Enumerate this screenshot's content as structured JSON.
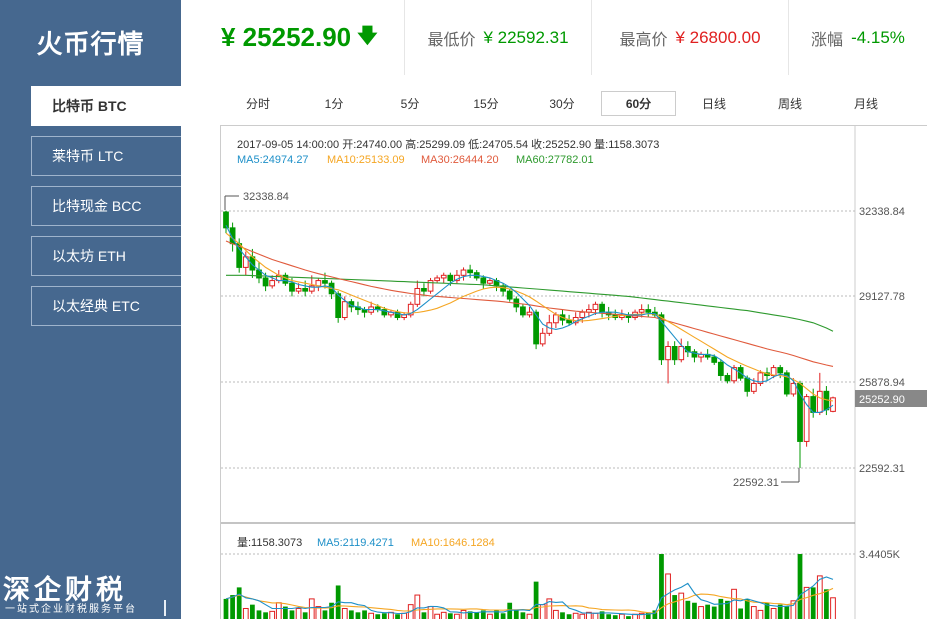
{
  "sidebar": {
    "brand": "火币行情",
    "items": [
      {
        "label": "比特币 BTC",
        "active": true
      },
      {
        "label": "莱特币 LTC",
        "active": false
      },
      {
        "label": "比特现金 BCC",
        "active": false
      },
      {
        "label": "以太坊 ETH",
        "active": false
      },
      {
        "label": "以太经典 ETC",
        "active": false
      }
    ],
    "watermark_title": "深企财税",
    "watermark_sub": "一站式企业财税服务平台"
  },
  "header": {
    "price": "¥ 25252.90",
    "low_label": "最低价",
    "low_value": "¥ 22592.31",
    "high_label": "最高价",
    "high_value": "¥ 26800.00",
    "change_label": "涨幅",
    "change_value": "-4.15%"
  },
  "tabs": [
    {
      "label": "分时",
      "active": false
    },
    {
      "label": "1分",
      "active": false
    },
    {
      "label": "5分",
      "active": false
    },
    {
      "label": "15分",
      "active": false
    },
    {
      "label": "30分",
      "active": false
    },
    {
      "label": "60分",
      "active": true
    },
    {
      "label": "日线",
      "active": false
    },
    {
      "label": "周线",
      "active": false
    },
    {
      "label": "月线",
      "active": false
    }
  ],
  "chart_info": {
    "line1": "2017-09-05 14:00:00   开:24740.00 高:25299.09 低:24705.54 收:25252.90 量:1158.3073",
    "ma5": "MA5:24974.27",
    "ma10": "MA10:25133.09",
    "ma30": "MA30:26444.20",
    "ma60": "MA60:27782.01",
    "vol": "量:1158.3073",
    "vol_ma5": "MA5:2119.4271",
    "vol_ma10": "MA10:1646.1284"
  },
  "colors": {
    "up": "#e02020",
    "down": "#009900",
    "ma5": "#1e90c8",
    "ma10": "#f5a623",
    "ma30": "#e05a3c",
    "ma60": "#2e9a2e",
    "sidebar": "#46688f"
  },
  "chart_data": {
    "type": "candlestick",
    "axis_ticks": [
      "32338.84",
      "29127.78",
      "25878.94",
      "22592.31"
    ],
    "current_price_tag": "25252.90",
    "max_label": "32338.84",
    "min_label": "22592.31",
    "vol_tick": "3.4405K",
    "ylim": [
      22592.31,
      32338.84
    ],
    "vol_max": 3440.5,
    "candles": [
      [
        32300,
        31700,
        32339,
        31500
      ],
      [
        31700,
        31100,
        31900,
        30800
      ],
      [
        31100,
        30200,
        31300,
        30000
      ],
      [
        30200,
        30600,
        30800,
        29900
      ],
      [
        30600,
        30100,
        30900,
        29800
      ],
      [
        30100,
        29800,
        30400,
        29600
      ],
      [
        29800,
        29500,
        30000,
        29300
      ],
      [
        29500,
        29700,
        29900,
        29400
      ],
      [
        29700,
        29900,
        30100,
        29600
      ],
      [
        29900,
        29600,
        30000,
        29500
      ],
      [
        29600,
        29300,
        29800,
        29100
      ],
      [
        29300,
        29400,
        29600,
        29200
      ],
      [
        29400,
        29300,
        29700,
        29100
      ],
      [
        29300,
        29500,
        29900,
        29200
      ],
      [
        29500,
        29700,
        29800,
        29300
      ],
      [
        29700,
        29600,
        30000,
        29400
      ],
      [
        29600,
        29200,
        29700,
        29000
      ],
      [
        29200,
        28300,
        29300,
        28100
      ],
      [
        28300,
        28900,
        29100,
        28200
      ],
      [
        28900,
        28700,
        29000,
        28500
      ],
      [
        28700,
        28600,
        28900,
        28400
      ],
      [
        28600,
        28500,
        28700,
        28300
      ],
      [
        28500,
        28700,
        28900,
        28400
      ],
      [
        28700,
        28600,
        28800,
        28500
      ],
      [
        28600,
        28400,
        28700,
        28300
      ],
      [
        28400,
        28500,
        28600,
        28300
      ],
      [
        28500,
        28300,
        28600,
        28200
      ],
      [
        28300,
        28400,
        28500,
        28200
      ],
      [
        28400,
        28800,
        28900,
        28300
      ],
      [
        28800,
        29400,
        29700,
        28700
      ],
      [
        29400,
        29300,
        29600,
        29100
      ],
      [
        29300,
        29700,
        29800,
        29200
      ],
      [
        29700,
        29800,
        29900,
        29600
      ],
      [
        29800,
        29900,
        30000,
        29600
      ],
      [
        29900,
        29700,
        30000,
        29500
      ],
      [
        29700,
        29900,
        30100,
        29600
      ],
      [
        29900,
        30100,
        30200,
        29700
      ],
      [
        30100,
        30000,
        30300,
        29800
      ],
      [
        30000,
        29800,
        30100,
        29700
      ],
      [
        29800,
        29600,
        29900,
        29400
      ],
      [
        29600,
        29700,
        29800,
        29500
      ],
      [
        29700,
        29500,
        29800,
        29300
      ],
      [
        29500,
        29300,
        29600,
        29100
      ],
      [
        29300,
        29000,
        29400,
        28900
      ],
      [
        29000,
        28700,
        29100,
        28500
      ],
      [
        28700,
        28400,
        28800,
        28300
      ],
      [
        28400,
        28500,
        28700,
        28300
      ],
      [
        28500,
        27300,
        28600,
        27100
      ],
      [
        27300,
        27700,
        27900,
        27200
      ],
      [
        27700,
        28100,
        28400,
        27600
      ],
      [
        28100,
        28400,
        28500,
        27900
      ],
      [
        28400,
        28200,
        28600,
        28000
      ],
      [
        28200,
        28100,
        28400,
        28000
      ],
      [
        28100,
        28300,
        28500,
        28000
      ],
      [
        28300,
        28500,
        28600,
        28100
      ],
      [
        28500,
        28600,
        28800,
        28300
      ],
      [
        28600,
        28800,
        28900,
        28400
      ],
      [
        28800,
        28500,
        28900,
        28300
      ],
      [
        28500,
        28400,
        28700,
        28200
      ],
      [
        28400,
        28300,
        28600,
        28200
      ],
      [
        28300,
        28400,
        28600,
        28200
      ],
      [
        28400,
        28300,
        28500,
        28100
      ],
      [
        28300,
        28500,
        28600,
        28200
      ],
      [
        28500,
        28600,
        28800,
        28300
      ],
      [
        28600,
        28500,
        28800,
        28300
      ],
      [
        28500,
        28400,
        28700,
        28300
      ],
      [
        28400,
        26700,
        28500,
        26500
      ],
      [
        26700,
        27200,
        27400,
        25800
      ],
      [
        27200,
        26700,
        27400,
        26500
      ],
      [
        26700,
        27200,
        27500,
        26600
      ],
      [
        27200,
        27000,
        27400,
        26800
      ],
      [
        27000,
        26800,
        27100,
        26600
      ],
      [
        26800,
        26900,
        27000,
        26600
      ],
      [
        26900,
        26800,
        27100,
        26700
      ],
      [
        26800,
        26600,
        26900,
        26500
      ],
      [
        26600,
        26100,
        26700,
        25900
      ],
      [
        26100,
        25900,
        26200,
        25800
      ],
      [
        25900,
        26400,
        26500,
        25800
      ],
      [
        26400,
        26000,
        26500,
        25900
      ],
      [
        26000,
        25500,
        26100,
        25300
      ],
      [
        25500,
        25800,
        26000,
        25400
      ],
      [
        25800,
        26200,
        26300,
        25700
      ],
      [
        26200,
        26100,
        26400,
        25900
      ],
      [
        26100,
        26400,
        26500,
        26000
      ],
      [
        26400,
        26200,
        26500,
        26000
      ],
      [
        26200,
        25400,
        26300,
        25300
      ],
      [
        25400,
        25800,
        26000,
        25300
      ],
      [
        25800,
        23600,
        25900,
        22592
      ],
      [
        23600,
        25300,
        25400,
        23400
      ],
      [
        25300,
        24700,
        25600,
        24500
      ],
      [
        24700,
        25500,
        26200,
        24600
      ],
      [
        25500,
        24800,
        25700,
        24600
      ],
      [
        24740,
        25253,
        25299,
        24705
      ]
    ],
    "volumes": [
      1100,
      1300,
      1700,
      600,
      800,
      500,
      400,
      450,
      900,
      700,
      500,
      600,
      400,
      1100,
      700,
      500,
      900,
      1800,
      600,
      500,
      400,
      500,
      350,
      300,
      350,
      400,
      300,
      350,
      800,
      1300,
      400,
      700,
      300,
      400,
      350,
      300,
      500,
      450,
      400,
      500,
      300,
      500,
      350,
      900,
      500,
      400,
      300,
      2000,
      800,
      1100,
      500,
      400,
      300,
      350,
      300,
      400,
      350,
      450,
      300,
      250,
      300,
      200,
      300,
      350,
      400,
      500,
      3440,
      2400,
      1300,
      1400,
      1000,
      900,
      700,
      800,
      700,
      1100,
      1000,
      1600,
      600,
      1100,
      700,
      500,
      900,
      600,
      800,
      700,
      1000,
      3440,
      1700,
      1700,
      2300,
      1600,
      1158
    ],
    "ma5": [
      31800,
      31300,
      30900,
      30600,
      30300,
      30100,
      29900,
      29800,
      29700,
      29700,
      29650,
      29550,
      29500,
      29450,
      29450,
      29500,
      29450,
      29150,
      28950,
      28750,
      28700,
      28600,
      28600,
      28600,
      28550,
      28500,
      28450,
      28400,
      28450,
      28600,
      28800,
      29000,
      29200,
      29400,
      29600,
      29750,
      29850,
      29900,
      29900,
      29850,
      29800,
      29700,
      29600,
      29450,
      29250,
      29000,
      28750,
      28400,
      28050,
      27900,
      27850,
      27900,
      28000,
      28150,
      28250,
      28350,
      28450,
      28500,
      28500,
      28500,
      28450,
      28400,
      28400,
      28400,
      28450,
      28450,
      28150,
      27850,
      27550,
      27250,
      27000,
      26950,
      26900,
      26900,
      26850,
      26700,
      26500,
      26350,
      26200,
      26000,
      25900,
      25850,
      25900,
      26050,
      26150,
      26100,
      25900,
      25400,
      25000,
      24700,
      24700,
      24800,
      24974
    ],
    "ma10": [
      31500,
      31300,
      31100,
      30850,
      30600,
      30400,
      30200,
      30050,
      29900,
      29800,
      29700,
      29650,
      29600,
      29550,
      29500,
      29450,
      29400,
      29350,
      29250,
      29150,
      29050,
      28950,
      28850,
      28750,
      28650,
      28580,
      28520,
      28480,
      28470,
      28490,
      28530,
      28580,
      28650,
      28750,
      28850,
      28980,
      29100,
      29200,
      29300,
      29380,
      29430,
      29450,
      29430,
      29380,
      29300,
      29200,
      29080,
      28920,
      28750,
      28580,
      28420,
      28300,
      28220,
      28180,
      28170,
      28190,
      28220,
      28260,
      28300,
      28340,
      28380,
      28400,
      28420,
      28430,
      28440,
      28430,
      28300,
      28150,
      28000,
      27850,
      27700,
      27550,
      27400,
      27250,
      27100,
      26950,
      26800,
      26680,
      26560,
      26450,
      26350,
      26250,
      26170,
      26120,
      26100,
      26050,
      25950,
      25800,
      25600,
      25400,
      25250,
      25180,
      25133
    ],
    "ma30": [
      31200,
      31100,
      31000,
      30900,
      30800,
      30700,
      30600,
      30500,
      30420,
      30340,
      30260,
      30180,
      30100,
      30030,
      29960,
      29900,
      29840,
      29780,
      29720,
      29660,
      29600,
      29540,
      29480,
      29430,
      29380,
      29330,
      29290,
      29250,
      29210,
      29180,
      29150,
      29120,
      29100,
      29080,
      29060,
      29040,
      29020,
      29000,
      28980,
      28960,
      28940,
      28920,
      28900,
      28870,
      28840,
      28810,
      28780,
      28740,
      28700,
      28660,
      28630,
      28600,
      28570,
      28540,
      28520,
      28500,
      28480,
      28460,
      28440,
      28420,
      28400,
      28380,
      28360,
      28340,
      28320,
      28300,
      28230,
      28160,
      28090,
      28020,
      27950,
      27880,
      27810,
      27740,
      27670,
      27600,
      27530,
      27460,
      27390,
      27320,
      27250,
      27180,
      27110,
      27050,
      26990,
      26930,
      26860,
      26780,
      26700,
      26620,
      26560,
      26500,
      26444
    ],
    "ma60": [
      29900,
      29900,
      29900,
      29900,
      29890,
      29880,
      29870,
      29860,
      29850,
      29840,
      29830,
      29820,
      29810,
      29800,
      29790,
      29780,
      29770,
      29760,
      29750,
      29740,
      29730,
      29720,
      29710,
      29700,
      29690,
      29680,
      29670,
      29660,
      29650,
      29640,
      29630,
      29620,
      29610,
      29600,
      29590,
      29580,
      29570,
      29560,
      29550,
      29540,
      29520,
      29500,
      29480,
      29460,
      29440,
      29420,
      29400,
      29380,
      29360,
      29340,
      29320,
      29300,
      29280,
      29260,
      29240,
      29220,
      29200,
      29180,
      29160,
      29140,
      29120,
      29100,
      29070,
      29040,
      29010,
      28980,
      28950,
      28920,
      28890,
      28860,
      28830,
      28800,
      28770,
      28740,
      28710,
      28680,
      28650,
      28620,
      28590,
      28560,
      28520,
      28480,
      28440,
      28400,
      28360,
      28320,
      28270,
      28220,
      28160,
      28100,
      28000,
      27900,
      27782
    ],
    "vol_ma5": [
      1100,
      1200,
      1350,
      1150,
      1100,
      1000,
      800,
      600,
      600,
      600,
      600,
      650,
      600,
      650,
      650,
      650,
      700,
      950,
      900,
      900,
      800,
      750,
      500,
      410,
      380,
      380,
      340,
      340,
      440,
      630,
      630,
      710,
      700,
      630,
      430,
      410,
      370,
      400,
      390,
      430,
      430,
      430,
      410,
      510,
      510,
      530,
      490,
      820,
      800,
      960,
      920,
      940,
      620,
      510,
      370,
      360,
      350,
      370,
      370,
      350,
      330,
      300,
      280,
      280,
      310,
      350,
      1150,
      1370,
      1570,
      1710,
      1910,
      1400,
      1060,
      960,
      820,
      840,
      860,
      1040,
      1000,
      1100,
      1000,
      900,
      780,
      740,
      700,
      720,
      760,
      1310,
      1530,
      1770,
      2120,
      2240,
      2119
    ],
    "vol_ma10": [
      1100,
      1200,
      1300,
      1200,
      1100,
      1000,
      950,
      890,
      890,
      850,
      780,
      710,
      650,
      630,
      620,
      620,
      640,
      740,
      730,
      710,
      690,
      680,
      640,
      610,
      580,
      550,
      500,
      470,
      480,
      520,
      540,
      560,
      580,
      580,
      580,
      570,
      560,
      580,
      580,
      540,
      520,
      520,
      510,
      530,
      530,
      540,
      530,
      650,
      680,
      730,
      740,
      750,
      730,
      740,
      720,
      630,
      600,
      540,
      530,
      520,
      510,
      520,
      490,
      430,
      380,
      350,
      640,
      840,
      950,
      1060,
      1140,
      1290,
      1350,
      1340,
      1300,
      1220,
      1160,
      1110,
      1100,
      1000,
      930,
      920,
      900,
      860,
      850,
      800,
      850,
      1070,
      1170,
      1290,
      1370,
      1490,
      1646
    ]
  }
}
